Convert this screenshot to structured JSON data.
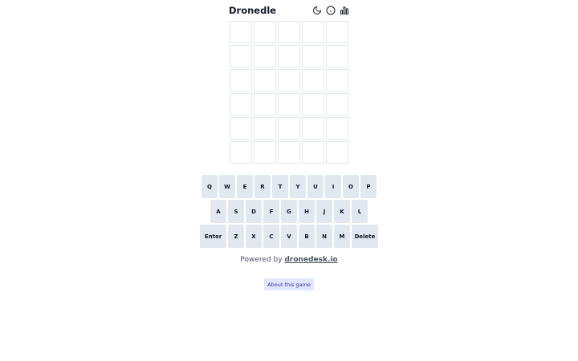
{
  "header": {
    "title": "Dronedle",
    "icons": [
      "moon-icon",
      "info-icon",
      "bar-chart-icon"
    ]
  },
  "board": {
    "rows": [
      [
        "",
        "",
        "",
        "",
        ""
      ],
      [
        "",
        "",
        "",
        "",
        ""
      ],
      [
        "",
        "",
        "",
        "",
        ""
      ],
      [
        "",
        "",
        "",
        "",
        ""
      ],
      [
        "",
        "",
        "",
        "",
        ""
      ],
      [
        "",
        "",
        "",
        "",
        ""
      ]
    ]
  },
  "keyboard": {
    "row1": [
      "Q",
      "W",
      "E",
      "R",
      "T",
      "Y",
      "U",
      "I",
      "O",
      "P"
    ],
    "row2": [
      "A",
      "S",
      "D",
      "F",
      "G",
      "H",
      "J",
      "K",
      "L"
    ],
    "row3": [
      "Enter",
      "Z",
      "X",
      "C",
      "V",
      "B",
      "N",
      "M",
      "Delete"
    ]
  },
  "footer": {
    "powered_prefix": "Powered by",
    "powered_link": "dronedesk.io",
    "about_label": "About this game"
  },
  "colors": {
    "key_bg": "#e2e8f0",
    "cell_border": "#e2e8f0",
    "about_bg": "#e0e7ff",
    "about_text": "#3730a3"
  }
}
